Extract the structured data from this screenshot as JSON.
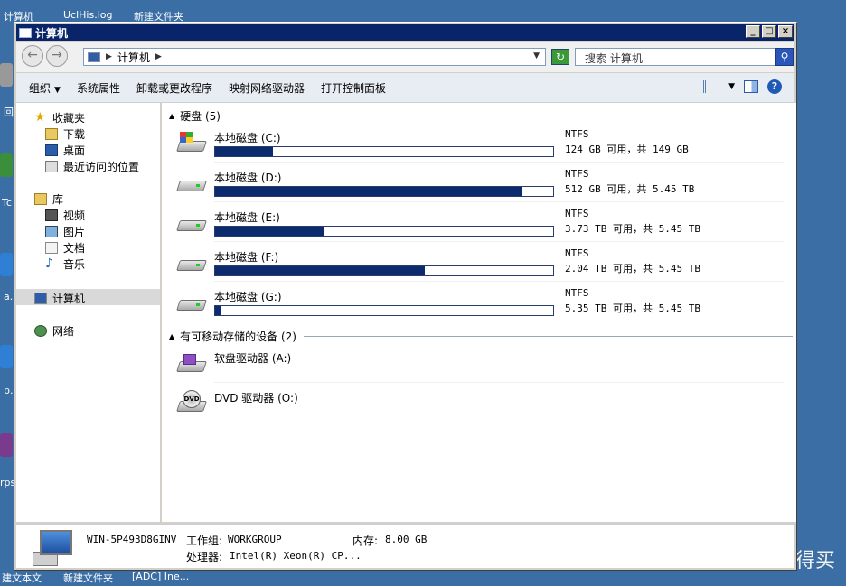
{
  "desktop": {
    "labels": [
      "计算机",
      "UclHis.log",
      "新建文件夹",
      "回",
      "Tc",
      "a.",
      "b.",
      "rps",
      "建文本文",
      "新建文件夹",
      "[ADC] Ine..."
    ],
    "watermark": "值 什么值得买"
  },
  "window": {
    "title": "计算机",
    "buttons": [
      "_",
      "□",
      "×"
    ]
  },
  "address": {
    "path": "计算机",
    "search_placeholder": "搜索 计算机"
  },
  "commands": {
    "items": [
      "组织",
      "系统属性",
      "卸载或更改程序",
      "映射网络驱动器",
      "打开控制面板"
    ]
  },
  "nav": {
    "favorites": "收藏夹",
    "downloads": "下载",
    "desktop": "桌面",
    "recent": "最近访问的位置",
    "libraries": "库",
    "videos": "视频",
    "pictures": "图片",
    "documents": "文档",
    "music": "音乐",
    "computer": "计算机",
    "network": "网络"
  },
  "groups": {
    "hard_disks": "硬盘 (5)",
    "removable": "有可移动存储的设备 (2)"
  },
  "drives": [
    {
      "name": "本地磁盘 (C:)",
      "fs": "NTFS",
      "free": "124 GB 可用，共 149 GB",
      "used_fraction": 0.17
    },
    {
      "name": "本地磁盘 (D:)",
      "fs": "NTFS",
      "free": "512 GB 可用，共 5.45 TB",
      "used_fraction": 0.91
    },
    {
      "name": "本地磁盘 (E:)",
      "fs": "NTFS",
      "free": "3.73 TB 可用，共 5.45 TB",
      "used_fraction": 0.32
    },
    {
      "name": "本地磁盘 (F:)",
      "fs": "NTFS",
      "free": "2.04 TB 可用，共 5.45 TB",
      "used_fraction": 0.62
    },
    {
      "name": "本地磁盘 (G:)",
      "fs": "NTFS",
      "free": "5.35 TB 可用，共 5.45 TB",
      "used_fraction": 0.02
    }
  ],
  "removable": [
    {
      "name": "软盘驱动器 (A:)"
    },
    {
      "name": "DVD 驱动器 (O:)"
    }
  ],
  "details": {
    "computer_name": "WIN-5P493D8GINV",
    "workgroup_label": "工作组:",
    "workgroup": "WORKGROUP",
    "memory_label": "内存:",
    "memory": "8.00 GB",
    "processor_label": "处理器:",
    "processor": "Intel(R) Xeon(R) CP..."
  },
  "colors": {
    "titlebar": "#0a246a",
    "usage_bar": "#0c2a6e",
    "desktop": "#3a6ea5"
  }
}
